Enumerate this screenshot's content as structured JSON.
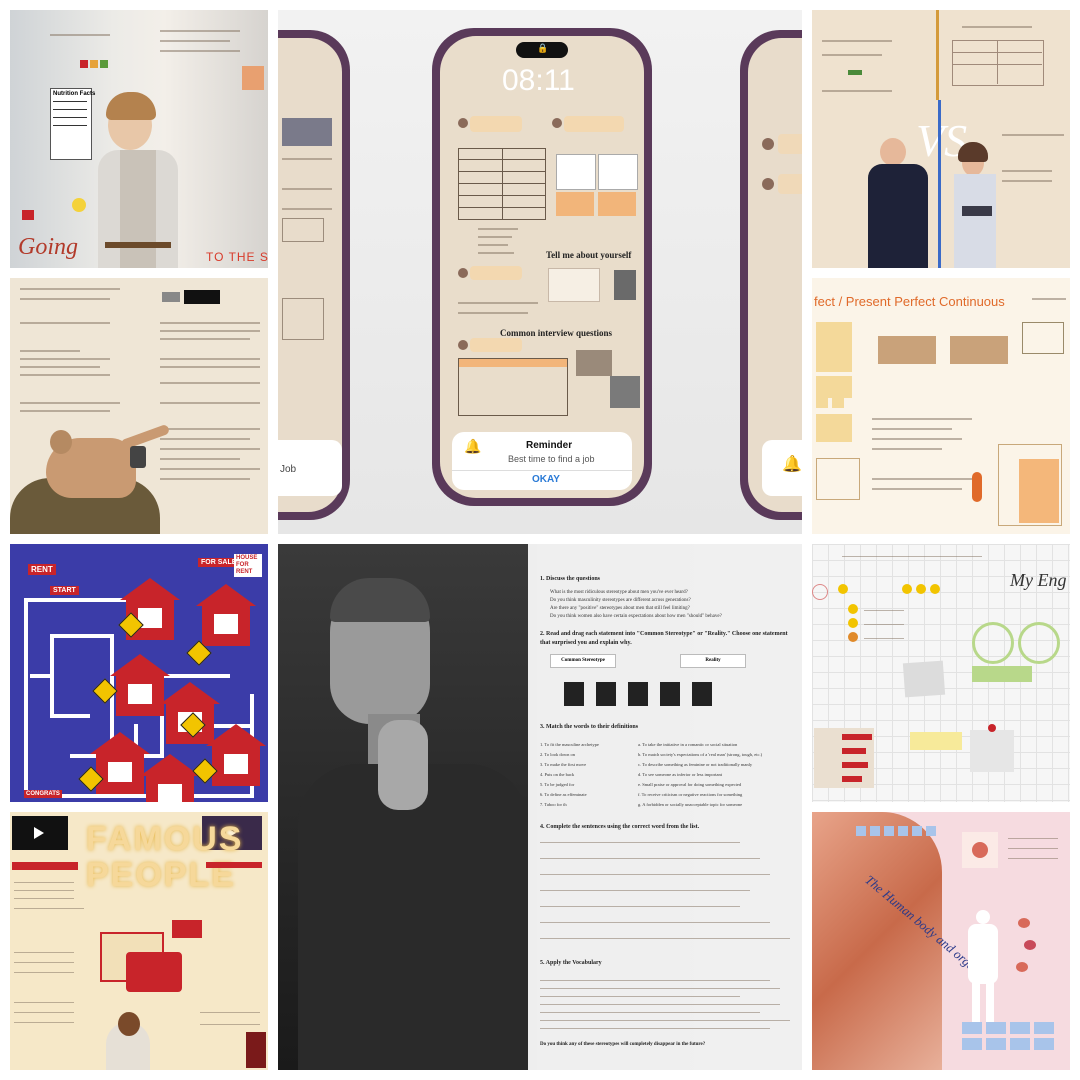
{
  "colors": {
    "accent_red": "#c8242a",
    "maze_blue": "#3b3ca8",
    "parchment": "#efe3d0",
    "phone_frame": "#5a3a5a",
    "notif_blue": "#2a7ad6"
  },
  "tile1": {
    "nutrition": "Nutrition Facts",
    "title": "Going",
    "subtitle": "TO THE SHO"
  },
  "phone": {
    "time": "08:11",
    "section_tell": "Tell me about yourself",
    "section_common": "Common interview questions",
    "notif_title": "Reminder",
    "notif_body": "Best time to find a job",
    "notif_button": "OKAY",
    "left_fragment": "Job",
    "bell_icon": "bell-icon"
  },
  "maze": {
    "rent": "RENT",
    "for_sale": "FOR SALE",
    "house_for_rent": "HOUSE FOR RENT",
    "start": "START",
    "congrats": "CONGRATS"
  },
  "famous": {
    "title_line1": "FAMOUS",
    "title_line2": "PEOPLE"
  },
  "perfect": {
    "title": "fect / Present Perfect Continuous"
  },
  "stereotype": {
    "q1": "1. Discuss the questions",
    "q1_items": [
      "What is the most ridiculous stereotype about men you've ever heard?",
      "Do you think masculinity stereotypes are different across generations?",
      "Are there any \"positive\" stereotypes about men that still feel limiting?",
      "Do you think women also have certain expectations about how men \"should\" behave?"
    ],
    "q2": "2. Read and drag each statement into \"Common Stereotype\" or \"Reality.\" Choose one statement that surprised you and explain why.",
    "col_stereotype": "Common Stereotype",
    "col_reality": "Reality",
    "q3": "3. Match the words to their definitions",
    "words": [
      "1. To fit the masculine archetype",
      "2. To look down on",
      "3. To make the first move",
      "4. Puts on the back",
      "5. To be judged for",
      "6. To define as effeminate",
      "7. Taboo for th"
    ],
    "defs": [
      "a. To take the initiative in a romantic or social situation",
      "b. To match society's expectations of a 'real man' (strong, tough, etc.)",
      "c. To describe something as feminine or not traditionally manly",
      "d. To see someone as inferior or less important",
      "e. Small praise or approval for doing something expected",
      "f. To receive criticism or negative reactions for something",
      "g. A forbidden or socially unacceptable topic for someone"
    ],
    "q4": "4. Complete the sentences using the correct word from the list.",
    "q5": "5. Apply the Vocabulary",
    "closing": "Do you think any of these stereotypes will completely disappear in the future?"
  },
  "english": {
    "title": "My Eng"
  },
  "human": {
    "title": "The Human body and organs"
  }
}
